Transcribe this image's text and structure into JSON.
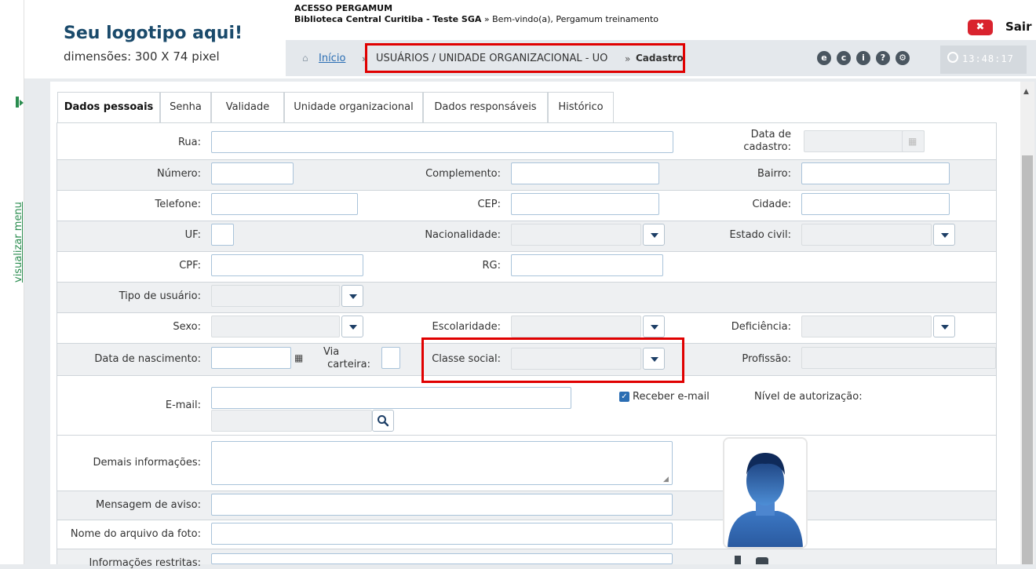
{
  "header": {
    "logo_title": "Seu logotipo aqui!",
    "logo_subtitle": "dimensões: 300 X 74 pixel",
    "acesso": "ACESSO PERGAMUM",
    "library": "Biblioteca Central Curitiba - Teste SGA",
    "welcome": "» Bem-vindo(a), Pergamum treinamento",
    "sair_icon": "x-icon",
    "sair_label": "Sair",
    "clock_time": "13:48:17"
  },
  "breadcrumb": {
    "home": "Início",
    "sep": "»",
    "path": "USUÁRIOS / UNIDADE ORGANIZACIONAL - UO",
    "current": "Cadastro"
  },
  "side": {
    "menu_label": "visualizar menu"
  },
  "tabs": [
    {
      "label": "Dados pessoais",
      "active": true
    },
    {
      "label": "Senha"
    },
    {
      "label": "Validade"
    },
    {
      "label": "Unidade organizacional"
    },
    {
      "label": "Dados responsáveis"
    },
    {
      "label": "Histórico"
    }
  ],
  "form": {
    "rua": "Rua:",
    "data_cadastro_1": "Data de",
    "data_cadastro_2": "cadastro:",
    "numero": "Número:",
    "complemento": "Complemento:",
    "bairro": "Bairro:",
    "telefone": "Telefone:",
    "cep": "CEP:",
    "cidade": "Cidade:",
    "uf": "UF:",
    "nacionalidade": "Nacionalidade:",
    "estado_civil": "Estado civil:",
    "cpf": "CPF:",
    "rg": "RG:",
    "tipo_usuario": "Tipo de usuário:",
    "sexo": "Sexo:",
    "escolaridade": "Escolaridade:",
    "deficiencia": "Deficiência:",
    "data_nascimento": "Data de nascimento:",
    "via_carteira_1": "Via",
    "via_carteira_2": "carteira:",
    "classe_social": "Classe social:",
    "profissao": "Profissão:",
    "email": "E-mail:",
    "receber_email": "Receber e-mail",
    "receber_email_checked": true,
    "nivel_autorizacao": "Nível de autorização:",
    "demais_info": "Demais informações:",
    "mensagem_aviso": "Mensagem de aviso:",
    "nome_arquivo_foto": "Nome do arquivo da foto:",
    "informacoes_restritas": "Informações restritas:"
  }
}
